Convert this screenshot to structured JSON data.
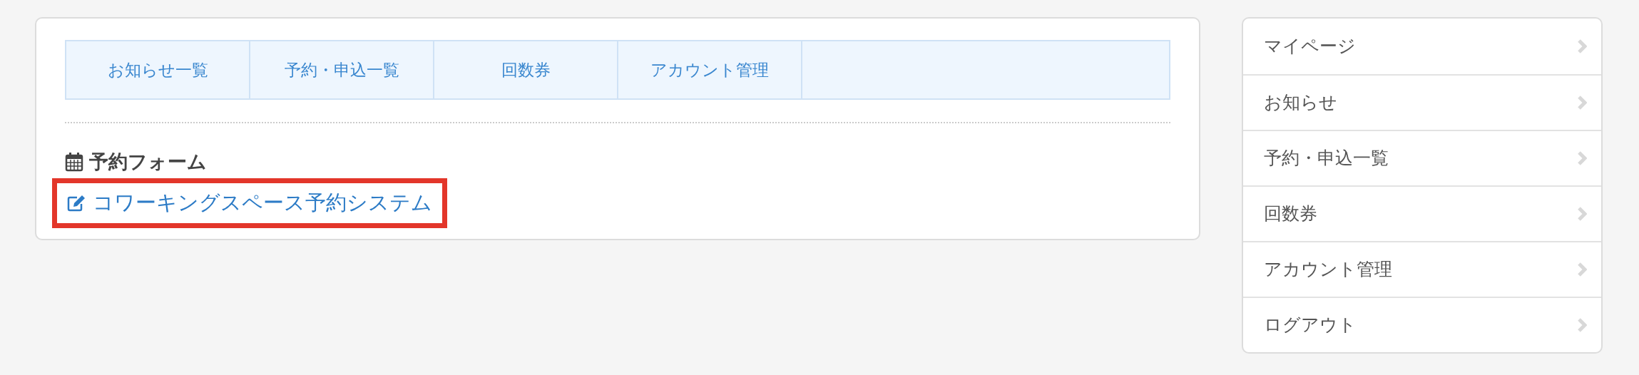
{
  "tabs": [
    {
      "label": "お知らせ一覧"
    },
    {
      "label": "予約・申込一覧"
    },
    {
      "label": "回数券"
    },
    {
      "label": "アカウント管理"
    }
  ],
  "section": {
    "heading": "予約フォーム",
    "link": {
      "label": "コワーキングスペース予約システム",
      "highlighted": true
    }
  },
  "sidebar": {
    "items": [
      {
        "label": "マイページ"
      },
      {
        "label": "お知らせ"
      },
      {
        "label": "予約・申込一覧"
      },
      {
        "label": "回数券"
      },
      {
        "label": "アカウント管理"
      },
      {
        "label": "ログアウト"
      }
    ]
  }
}
